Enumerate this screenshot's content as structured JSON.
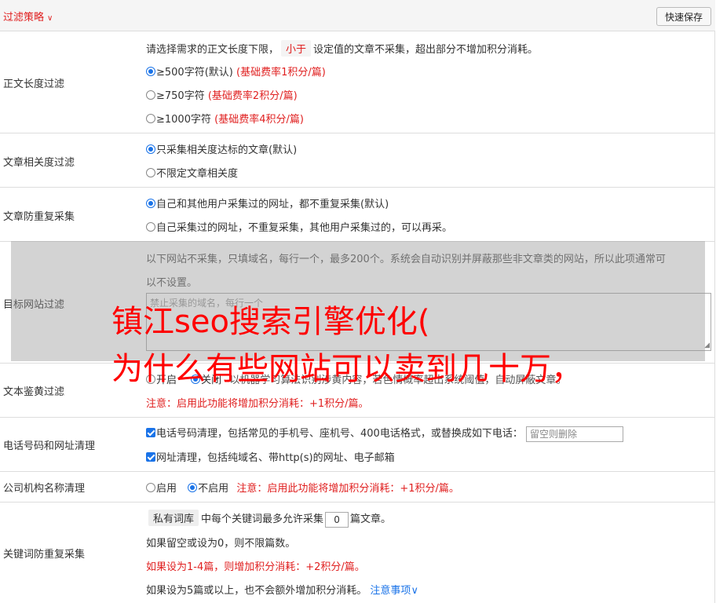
{
  "header": {
    "title": "过滤策略",
    "title_icon": "chevron-double-down-icon",
    "save_button": "快速保存"
  },
  "content_length": {
    "label": "正文长度过滤",
    "desc_before": "请选择需求的正文长度下限，",
    "desc_tag": "小于",
    "desc_after": "设定值的文章不采集，超出部分不增加积分消耗。",
    "options": [
      {
        "text": "≥500字符(默认)",
        "note": "(基础费率1积分/篇)",
        "selected": true
      },
      {
        "text": "≥750字符",
        "note": "(基础费率2积分/篇)",
        "selected": false
      },
      {
        "text": "≥1000字符",
        "note": "(基础费率4积分/篇)",
        "selected": false
      }
    ]
  },
  "relevance": {
    "label": "文章相关度过滤",
    "options": [
      {
        "text": "只采集相关度达标的文章(默认)",
        "selected": true
      },
      {
        "text": "不限定文章相关度",
        "selected": false
      }
    ]
  },
  "duplicate": {
    "label": "文章防重复采集",
    "options": [
      {
        "text": "自己和其他用户采集过的网址，都不重复采集(默认)",
        "selected": true
      },
      {
        "text": "自己采集过的网址，不重复采集，其他用户采集过的，可以再采。",
        "selected": false
      }
    ]
  },
  "site_filter": {
    "label": "目标网站过滤",
    "desc_line1": "以下网站不采集，只填域名，每行一个，最多200个。系统会自动识别并屏蔽那些非文章类的网站，所以此项通常可",
    "desc_line2": "以不设置。",
    "placeholder": "禁止采集的域名，每行一个"
  },
  "porn_filter": {
    "label": "文本鉴黄过滤",
    "opt_on": "开启",
    "opt_off_partial": "关闭",
    "hidden_desc": "以机器学习算法识别涉黄内容，若色情概率超出系统阈值，自动屏蔽文章。",
    "note": "注意：启用此功能将增加积分消耗：+1积分/篇。"
  },
  "phone_clean": {
    "label": "电话号码和网址清理",
    "phone_text": "电话号码清理，包括常见的手机号、座机号、400电话格式，或替换成如下电话：",
    "phone_placeholder": "留空则删除",
    "url_text": "网址清理，包括纯域名、带http(s)的网址、电子邮箱"
  },
  "company_clean": {
    "label": "公司机构名称清理",
    "opt_on": "启用",
    "opt_off": "不启用",
    "note": "注意：启用此功能将增加积分消耗：+1积分/篇。"
  },
  "keyword_dup": {
    "label": "关键词防重复采集",
    "tag": "私有词库",
    "line1_a": "中每个关键词最多允许采集",
    "line1_value": "0",
    "line1_b": "篇文章。",
    "line2": "如果留空或设为0，则不限篇数。",
    "line3": "如果设为1-4篇，则增加积分消耗：+2积分/篇。",
    "line4": "如果设为5篇或以上，也不会额外增加积分消耗。",
    "link": "注意事项"
  },
  "overlay": {
    "line1": "镇江seo搜索引擎优化(",
    "line2": "为什么有些网站可以卖到几十万，"
  }
}
